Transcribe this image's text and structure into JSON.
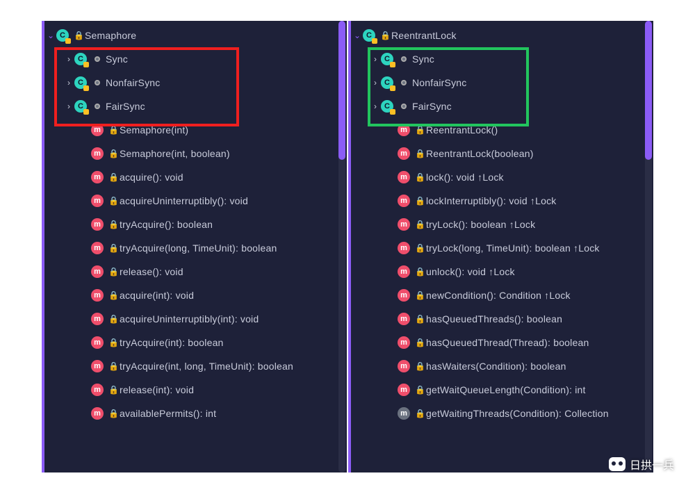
{
  "left": {
    "root": "Semaphore",
    "highlight_color": "#ef1f1f",
    "sync_items": [
      "Sync",
      "NonfairSync",
      "FairSync"
    ],
    "methods": [
      {
        "sig": "Semaphore(int)"
      },
      {
        "sig": "Semaphore(int, boolean)"
      },
      {
        "sig": "acquire(): void"
      },
      {
        "sig": "acquireUninterruptibly(): void"
      },
      {
        "sig": "tryAcquire(): boolean"
      },
      {
        "sig": "tryAcquire(long, TimeUnit): boolean"
      },
      {
        "sig": "release(): void"
      },
      {
        "sig": "acquire(int): void"
      },
      {
        "sig": "acquireUninterruptibly(int): void"
      },
      {
        "sig": "tryAcquire(int): boolean"
      },
      {
        "sig": "tryAcquire(int, long, TimeUnit): boolean"
      },
      {
        "sig": "release(int): void"
      },
      {
        "sig": "availablePermits(): int"
      }
    ]
  },
  "right": {
    "root": "ReentrantLock",
    "highlight_color": "#22c55e",
    "sync_items": [
      "Sync",
      "NonfairSync",
      "FairSync"
    ],
    "methods": [
      {
        "sig": "ReentrantLock()"
      },
      {
        "sig": "ReentrantLock(boolean)"
      },
      {
        "sig": "lock(): void ↑Lock"
      },
      {
        "sig": "lockInterruptibly(): void ↑Lock"
      },
      {
        "sig": "tryLock(): boolean ↑Lock"
      },
      {
        "sig": "tryLock(long, TimeUnit): boolean ↑Lock"
      },
      {
        "sig": "unlock(): void ↑Lock"
      },
      {
        "sig": "newCondition(): Condition ↑Lock"
      },
      {
        "sig": "hasQueuedThreads(): boolean"
      },
      {
        "sig": "hasQueuedThread(Thread): boolean"
      },
      {
        "sig": "hasWaiters(Condition): boolean"
      },
      {
        "sig": "getWaitQueueLength(Condition): int"
      },
      {
        "sig": "getWaitingThreads(Condition): Collection",
        "gray": true
      }
    ]
  },
  "watermark": "日拱一兵"
}
